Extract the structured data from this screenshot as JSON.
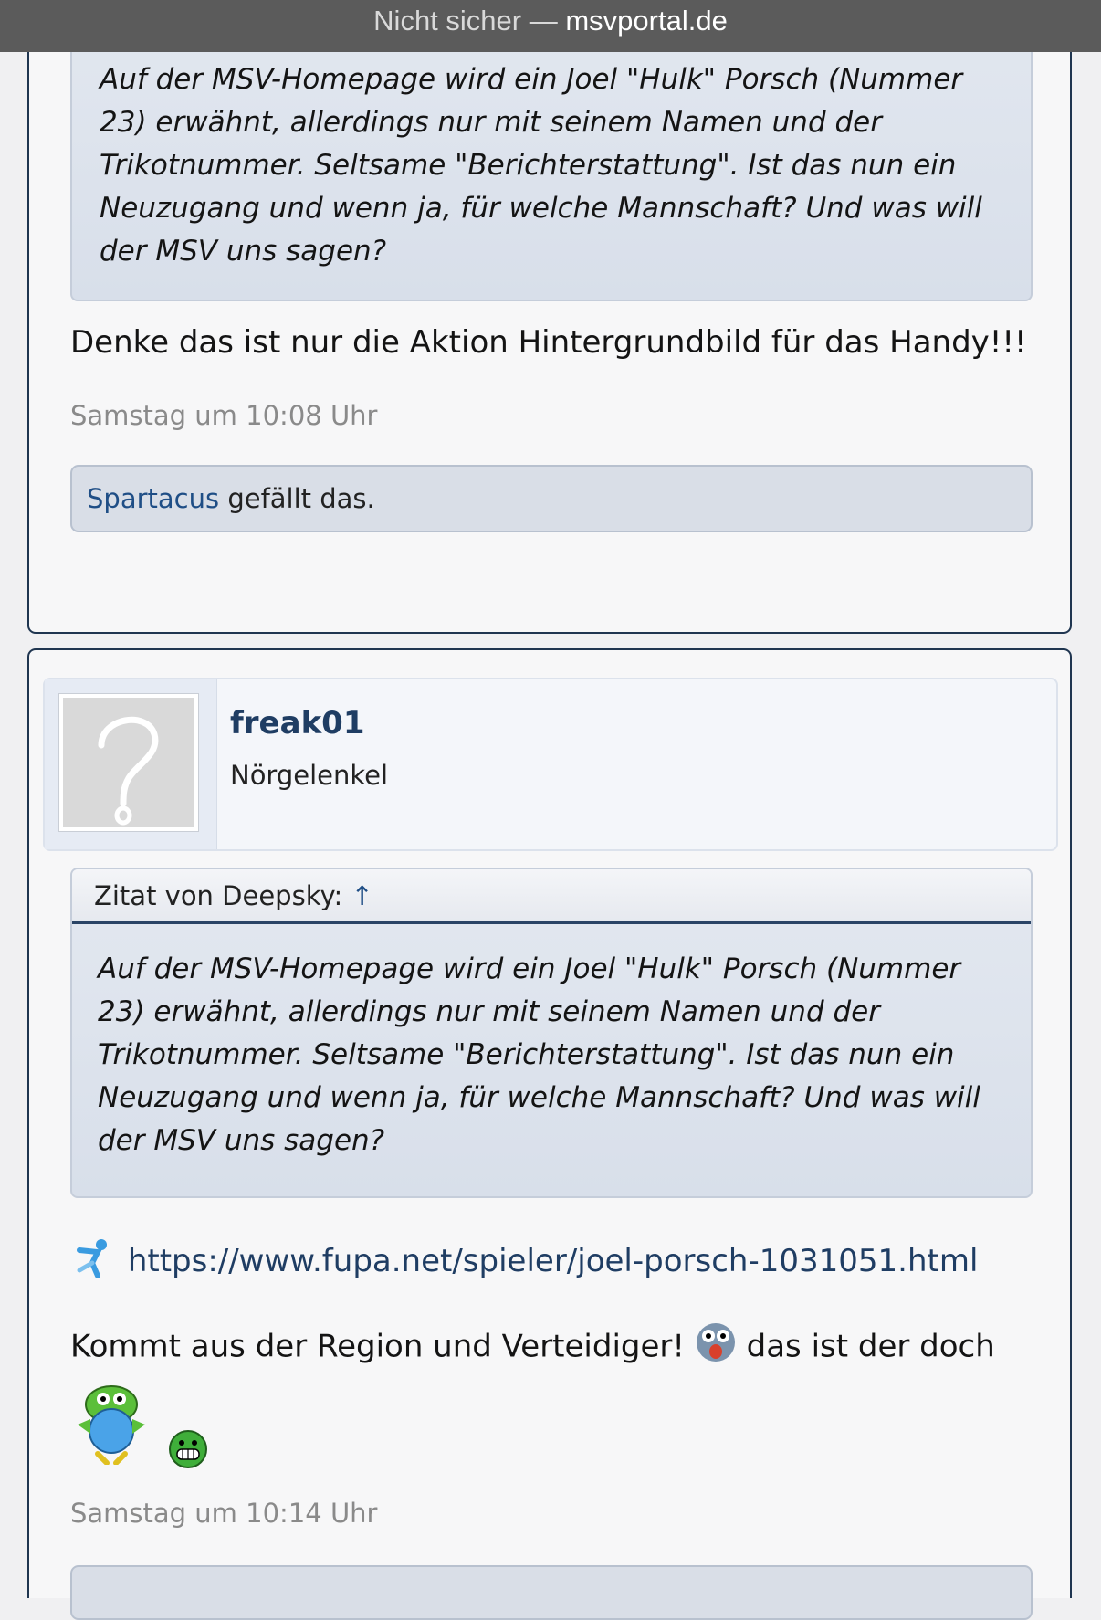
{
  "browser": {
    "security_label": "Nicht sicher —",
    "host": "msvportal.de"
  },
  "post1": {
    "quote_text": "Auf der MSV-Homepage wird ein Joel \"Hulk\" Porsch (Nummer 23) erwähnt, allerdings nur mit seinem Namen und der Trikotnummer. Seltsame \"Berichterstattung\". Ist das nun ein Neuzugang und wenn ja, für welche Mannschaft? Und was will der MSV uns sagen?",
    "message": "Denke das ist nur die Aktion Hintergrundbild für das Handy!!!",
    "timestamp": "Samstag um 10:08 Uhr",
    "liker": "Spartacus",
    "likes_suffix": "gefällt das."
  },
  "post2": {
    "username": "freak01",
    "user_title": "Nörgelenkel",
    "quote_header": "Zitat von Deepsky:",
    "quote_arrow": "↑",
    "quote_text": "Auf der MSV-Homepage wird ein Joel \"Hulk\" Porsch (Nummer 23) erwähnt, allerdings nur mit seinem Namen und der Trikotnummer. Seltsame \"Berichterstattung\". Ist das nun ein Neuzugang und wenn ja, für welche Mannschaft? Und was will der MSV uns sagen?",
    "link": "https://www.fupa.net/spieler/joel-porsch-1031051.html",
    "message_part1": "Kommt aus der Region und Verteidiger!",
    "message_part2": "das ist der doch",
    "timestamp": "Samstag um 10:14 Uhr"
  },
  "icons": {
    "link_icon": "fupa-kicker-icon",
    "emoji_1": "shocked-face-emoji",
    "emoji_2": "green-globe-monster-emoji",
    "emoji_3": "grinning-green-face-emoji"
  },
  "colors": {
    "link": "#1f4e86",
    "username": "#1f3d63",
    "post_border": "#1f3550",
    "quote_bg": "#dde3ed"
  }
}
